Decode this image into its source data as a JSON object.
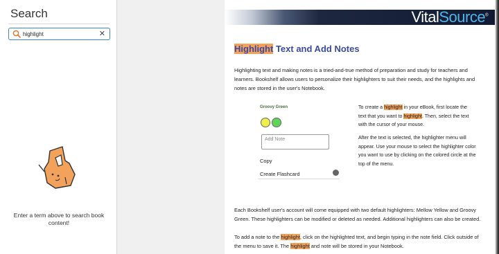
{
  "sidebar": {
    "title": "Search",
    "search_value": "highlight",
    "clear_label": "✕",
    "empty_message": "Enter a term above to search book content!"
  },
  "logo": {
    "part1": "Vital",
    "part2": "Source",
    "reg": "®"
  },
  "content": {
    "heading": {
      "hl": "Highlight",
      "rest": " Text and Add Notes"
    },
    "intro": "Highlighting text and making notes is a tried-and-true method of preparation and study for teachers and learners. Bookshelf allows users to personalize their highlighters to suit their needs,  and the highlights and notes are stored in the user's Notebook.",
    "menu": {
      "title": "Groovy Green",
      "note_placeholder": "Add Note",
      "copy": "Copy",
      "flashcard": "Create Flashcard",
      "swatch_colors": [
        "#eef04a",
        "#5fd65a"
      ]
    },
    "side1": {
      "a": "To create a ",
      "hl1": "highlight",
      "b": " in your eBook, first locate the text that you want to ",
      "hl2": "highlight",
      "c": ".  Then, select the text with the cursor of your mouse."
    },
    "side2": "After the text is selected, the highlighter menu will appear.  Use your mouse to select the highlighter color you want to use by clicking on the colored circle at the top of the menu.",
    "p3": "Each Bookshelf user's account will come equipped with two default highlighters:  Mellow Yellow and Groovy Green. These highlighters can be modified or deleted as needed. Additional highlighters can also be created.",
    "p4": {
      "a": "To add a note to the ",
      "hl1": "highlight",
      "b": ", click on the highlighted text, and begin typing in the note field. Click outside of the menu to save it. The ",
      "hl2": "highlight",
      "c": " and note will be stored in your Notebook."
    }
  },
  "colors": {
    "highlight": "#f2a25b",
    "heading": "#3a4aa3",
    "accent": "#3b86c6"
  }
}
